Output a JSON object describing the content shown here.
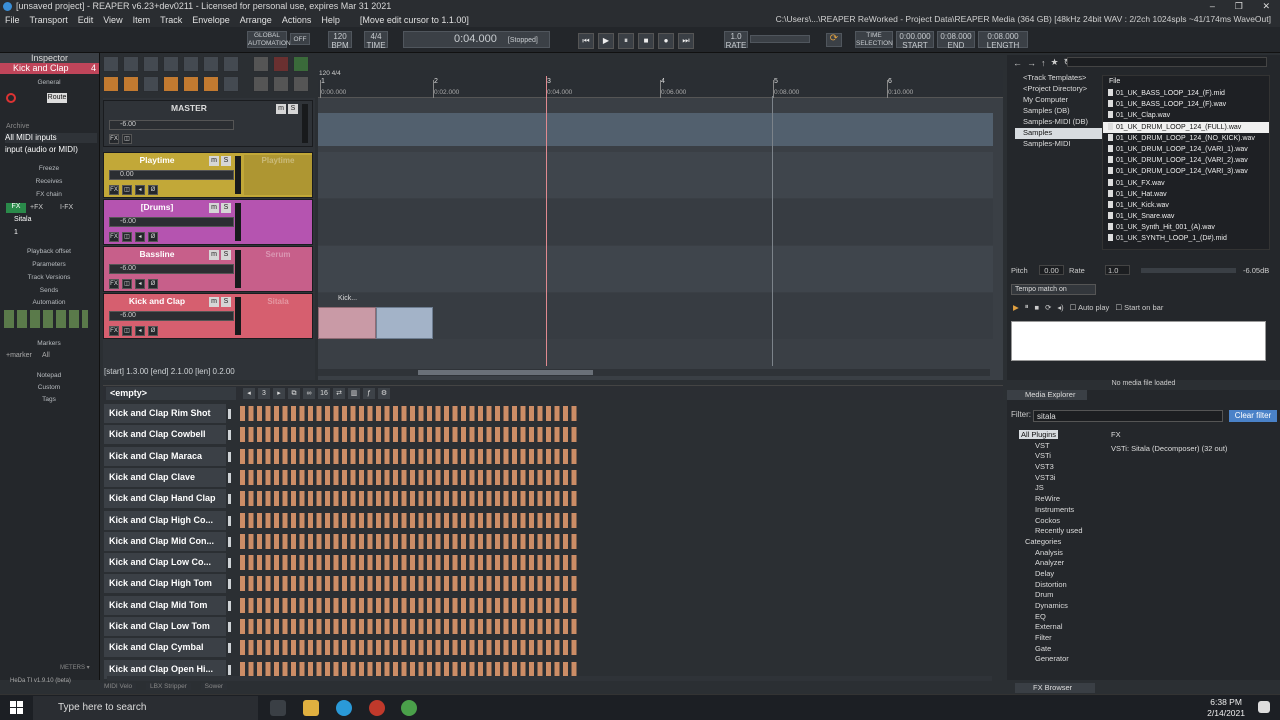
{
  "window": {
    "title": "[unsaved project] - REAPER v6.23+dev0211 - Licensed for personal use, expires Mar 31 2021",
    "controls": [
      "–",
      "❐",
      "✕"
    ]
  },
  "menu": {
    "items": [
      "File",
      "Transport",
      "Edit",
      "View",
      "Item",
      "Track",
      "Envelope",
      "Arrange",
      "Actions",
      "Help"
    ],
    "status": "[Move edit cursor to 1.1.00]",
    "info": "C:\\Users\\...\\REAPER ReWorked - Project Data\\REAPER Media (364 GB) [48kHz 24bit WAV : 2/2ch 1024spls ~41/174ms WaveOut]"
  },
  "transport": {
    "global_auto": "GLOBAL AUTOMATION",
    "off": "OFF",
    "bpm": "120",
    "bpm_lbl": "BPM",
    "sig": "4/4",
    "sig_lbl": "TIME",
    "position": "0:04.000",
    "state": "[Stopped]",
    "rate": "1.0",
    "rate_lbl": "RATE",
    "sel_lbl": "TIME SELECTION",
    "start": "0:00.000",
    "end": "0:08.000",
    "length": "0:08.000",
    "start_lbl": "START",
    "end_lbl": "END",
    "len_lbl": "LENGTH",
    "btn_start": "⏮",
    "btn_play": "▶",
    "btn_pause": "⏸",
    "btn_stop": "■",
    "btn_rec": "●",
    "btn_end": "⏭"
  },
  "inspector": {
    "title": "Inspector",
    "track": "Kick and Clap",
    "num": "4",
    "general": "General",
    "input1": "All MIDI inputs",
    "input2": "input (audio or MIDI)",
    "archive": "Archive",
    "route": "Route",
    "freeze": "Freeze",
    "receives": "Receives",
    "fxchain": "FX chain",
    "fx_plus": "+FX",
    "i_fx": "I-FX",
    "fx_item": "Sitala",
    "one": "1",
    "playback_offset": "Playback offset",
    "parameters": "Parameters",
    "track_versions": "Track Versions",
    "sends": "Sends",
    "automation": "Automation",
    "markers": "Markers",
    "marker_add": "+marker",
    "marker_all": "All",
    "notepad": "Notepad",
    "custom": "Custom",
    "tags": "Tags",
    "meters": "METERS ▾",
    "version": "HeDa TI v1.9.10 (beta)"
  },
  "tracks": [
    {
      "name": "MASTER",
      "vol": "-6.00",
      "fx": "",
      "color": "#2f3338"
    },
    {
      "name": "Playtime",
      "vol": "0.00",
      "fx": "Playtime",
      "color": "#c2a838"
    },
    {
      "name": "[Drums]",
      "vol": "-6.00",
      "fx": "",
      "color": "#b554b0"
    },
    {
      "name": "Bassline",
      "vol": "-6.00",
      "fx": "Serum",
      "color": "#c75f8a"
    },
    {
      "name": "Kick and Clap",
      "vol": "-6.00",
      "fx": "Sitala",
      "color": "#d65f6f"
    }
  ],
  "ruler": {
    "tempo": "120 4/4",
    "bars": [
      {
        "n": "1",
        "t": "0:00.000"
      },
      {
        "n": "2",
        "t": "0:02.000"
      },
      {
        "n": "3",
        "t": "0:04.000"
      },
      {
        "n": "4",
        "t": "0:06.000"
      },
      {
        "n": "5",
        "t": "0:08.000"
      },
      {
        "n": "6",
        "t": "0:10.000"
      }
    ]
  },
  "item_label": "Kick...",
  "statusline": "[start] 1.3.00 [end] 2.1.00 [len] 0.2.00",
  "sequencer": {
    "pattern": "<empty>",
    "steps": "16",
    "page": "3",
    "rows": [
      "Kick and Clap Rim Shot",
      "Kick and Clap Cowbell",
      "Kick and Clap Maraca",
      "Kick and Clap Clave",
      "Kick and Clap Hand Clap",
      "Kick and Clap High Co...",
      "Kick and Clap Mid Con...",
      "Kick and Clap Low Co...",
      "Kick and Clap High Tom",
      "Kick and Clap Mid Tom",
      "Kick and Clap Low Tom",
      "Kick and Clap Cymbal",
      "Kick and Clap Open Hi..."
    ]
  },
  "browser": {
    "nav": [
      "←",
      "→",
      "↑",
      "★",
      "↻"
    ],
    "file_header": "File",
    "tree": [
      "<Track Templates>",
      "<Project Directory>",
      "My Computer",
      "Samples (DB)",
      "Samples-MIDI (DB)",
      "Samples",
      "Samples-MIDI"
    ],
    "tree_selected": "Samples",
    "files": [
      "01_UK_BASS_LOOP_124_(F).mid",
      "01_UK_BASS_LOOP_124_(F).wav",
      "01_UK_Clap.wav",
      "01_UK_DRUM_LOOP_124_(FULL).wav",
      "01_UK_DRUM_LOOP_124_(NO_KICK).wav",
      "01_UK_DRUM_LOOP_124_(VARI_1).wav",
      "01_UK_DRUM_LOOP_124_(VARI_2).wav",
      "01_UK_DRUM_LOOP_124_(VARI_3).wav",
      "01_UK_FX.wav",
      "01_UK_Hat.wav",
      "01_UK_Kick.wav",
      "01_UK_Snare.wav",
      "01_UK_Synth_Hit_001_(A).wav",
      "01_UK_SYNTH_LOOP_1_(D#).mid"
    ],
    "file_selected": "01_UK_DRUM_LOOP_124_(FULL).wav",
    "pitch_lbl": "Pitch",
    "pitch": "0.00",
    "rate_lbl": "Rate",
    "rate": "1.0",
    "gain": "-6.05dB",
    "tempo_match": "Tempo match on",
    "autoplay": "Auto play",
    "startbar": "Start on bar",
    "nomedia": "No media file loaded",
    "tab": "Media Explorer"
  },
  "fxbrowser": {
    "filter_lbl": "Filter:",
    "filter": "sitala",
    "clear": "Clear filter",
    "tree": [
      "All Plugins",
      "VST",
      "VSTi",
      "VST3",
      "VST3i",
      "JS",
      "ReWire",
      "Instruments",
      "Cockos",
      "Recently used",
      "Categories",
      "Analysis",
      "Analyzer",
      "Delay",
      "Distortion",
      "Drum",
      "Dynamics",
      "EQ",
      "External",
      "Filter",
      "Gate",
      "Generator"
    ],
    "col": "FX",
    "result": "VSTi: Sitala (Decomposer) (32 out)",
    "tab": "FX Browser"
  },
  "bottomtabs": [
    "MIDI Velo",
    "LBX Stripper",
    "Sower"
  ],
  "taskbar": {
    "search": "Type here to search",
    "time": "6:38 PM",
    "date": "2/14/2021"
  }
}
